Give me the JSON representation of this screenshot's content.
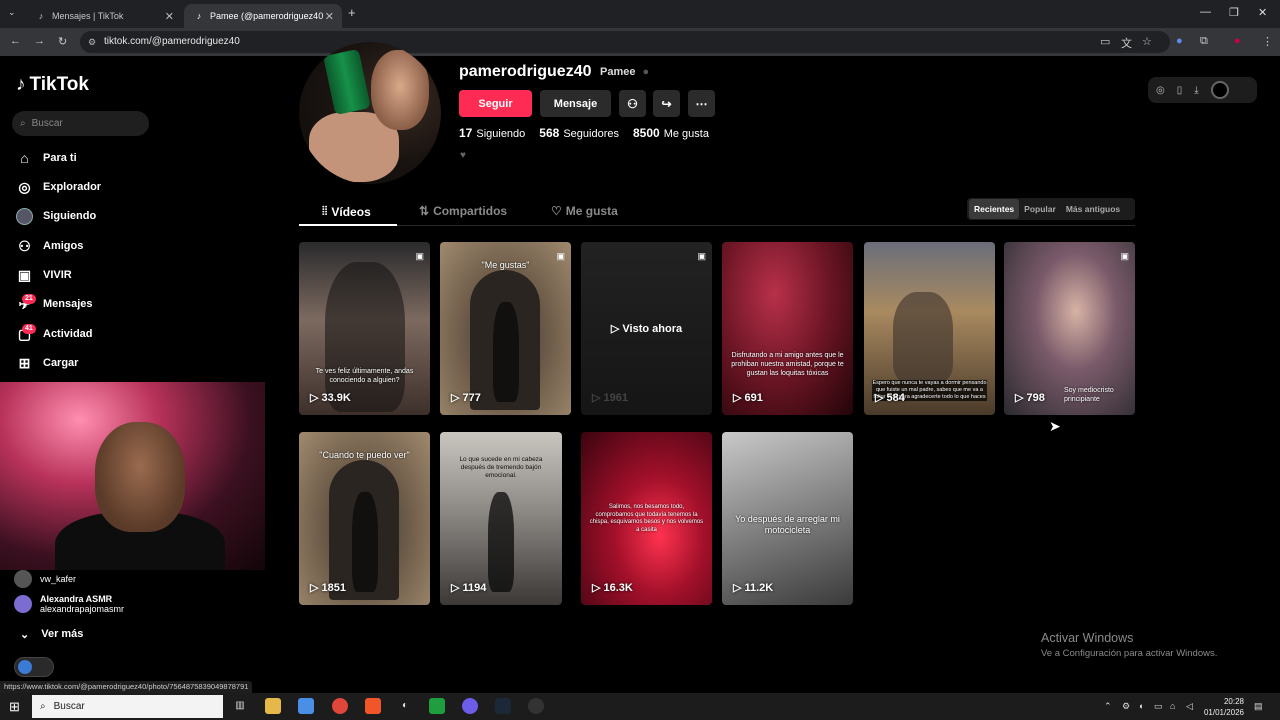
{
  "browser": {
    "tabs": [
      {
        "title": "Mensajes | TikTok"
      },
      {
        "title": "Pamee   (@pamerodriguez40"
      }
    ],
    "url": "tiktok.com/@pamerodriguez40",
    "status_url": "https://www.tiktok.com/@pamerodriguez40/photo/7564875839049878791"
  },
  "sidebar": {
    "logo": "TikTok",
    "search_placeholder": "Buscar",
    "items": [
      {
        "label": "Para ti",
        "icon": "home-icon"
      },
      {
        "label": "Explorador",
        "icon": "compass-icon"
      },
      {
        "label": "Siguiendo",
        "icon": "following-avatar-icon"
      },
      {
        "label": "Amigos",
        "icon": "friends-icon"
      },
      {
        "label": "VIVIR",
        "icon": "live-icon"
      },
      {
        "label": "Mensajes",
        "icon": "message-icon",
        "badge": "21"
      },
      {
        "label": "Actividad",
        "icon": "activity-icon",
        "badge": "41"
      },
      {
        "label": "Cargar",
        "icon": "upload-icon"
      }
    ],
    "following": [
      {
        "name": "vw_kafer",
        "handle": ""
      },
      {
        "name": "Alexandra ASMR",
        "handle": "alexandrapajomasmr"
      }
    ],
    "see_more": "Ver más"
  },
  "profile": {
    "username": "pamerodriguez40",
    "nickname": "Pamee",
    "follow_label": "Seguir",
    "message_label": "Mensaje",
    "stats": [
      {
        "value": "17",
        "label": "Siguiendo"
      },
      {
        "value": "568",
        "label": "Seguidores"
      },
      {
        "value": "8500",
        "label": "Me gusta"
      }
    ],
    "tabs": [
      {
        "label": "Vídeos"
      },
      {
        "label": "Compartidos"
      },
      {
        "label": "Me gusta"
      }
    ],
    "sort": [
      {
        "label": "Recientes"
      },
      {
        "label": "Popular"
      },
      {
        "label": "Más antiguos"
      }
    ]
  },
  "videos": [
    {
      "views": "33.9K",
      "caption": "Te ves feliz últimamente, andas conociendo a alguien?"
    },
    {
      "views": "777",
      "caption": "\"Me gustas\""
    },
    {
      "views": "1961",
      "caption": "",
      "overlay": "Visto ahora"
    },
    {
      "views": "691",
      "caption": "Disfrutando a mi amigo antes que le prohiban nuestra amistad, porque te gustan las loquitas tóxicas"
    },
    {
      "views": "584",
      "caption": "Espero que nunca te vayas a dormir pensando que fuiste un mal padre, sabes que me va a faltar vida para agradecerte todo lo que haces"
    },
    {
      "views": "798",
      "caption": "Soy mediocristo principiante"
    },
    {
      "views": "1851",
      "caption": "\"Cuando te puedo ver\""
    },
    {
      "views": "1194",
      "caption": "Lo que sucede en mi cabeza después de tremendo bajón emocional."
    },
    {
      "views": "16.3K",
      "caption": "Salimos, nos besamos todo, comprobamos que todavía tenemos la chispa, esquivamos besos y nos volvemos a casita"
    },
    {
      "views": "11.2K",
      "caption": "Yo después de arreglar mi motocicleta"
    }
  ],
  "windows": {
    "activate_title": "Activar Windows",
    "activate_sub": "Ve a Configuración para activar Windows.",
    "taskbar_search": "Buscar",
    "time": "20:28",
    "date": "01/01/2026"
  },
  "colors": {
    "accent": "#fe2c55",
    "background": "#000000"
  }
}
